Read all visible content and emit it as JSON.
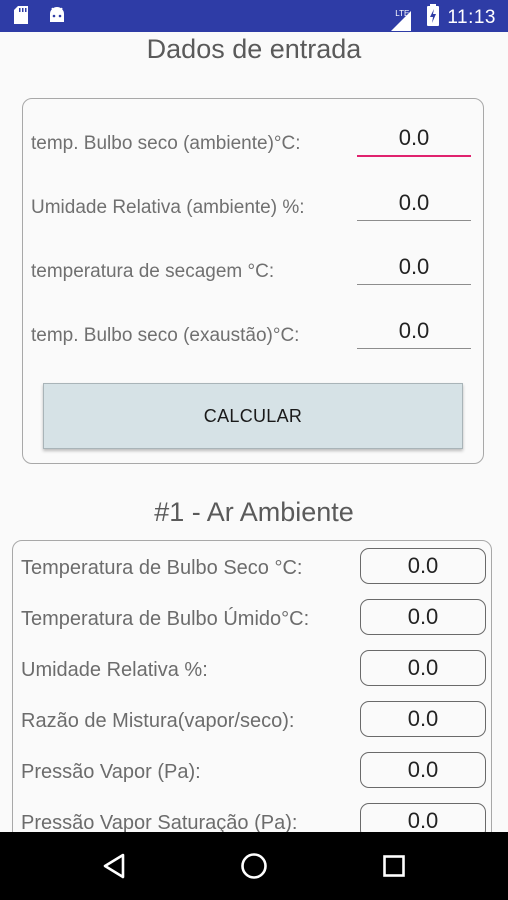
{
  "status_bar": {
    "time": "11:13",
    "network_label": "LTE",
    "icons": [
      "sd-card-icon",
      "android-icon",
      "signal-icon",
      "battery-charging-icon"
    ]
  },
  "input_section": {
    "title": "Dados de entrada",
    "fields": [
      {
        "label": "temp. Bulbo seco (ambiente)°C:",
        "value": "0.0",
        "focused": true
      },
      {
        "label": "Umidade Relativa (ambiente) %:",
        "value": "0.0",
        "focused": false
      },
      {
        "label": "temperatura de secagem °C:",
        "value": "0.0",
        "focused": false
      },
      {
        "label": "temp. Bulbo seco (exaustão)°C:",
        "value": "0.0",
        "focused": false
      }
    ],
    "calculate_label": "CALCULAR"
  },
  "results_section": {
    "title": "#1 - Ar Ambiente",
    "rows": [
      {
        "label": "Temperatura de Bulbo Seco °C:",
        "value": "0.0"
      },
      {
        "label": "Temperatura de Bulbo Úmido°C:",
        "value": "0.0"
      },
      {
        "label": "Umidade Relativa %:",
        "value": "0.0"
      },
      {
        "label": "Razão de Mistura(vapor/seco):",
        "value": "0.0"
      },
      {
        "label": "Pressão Vapor (Pa):",
        "value": "0.0"
      },
      {
        "label": "Pressão Vapor Saturação (Pa):",
        "value": "0.0"
      }
    ]
  },
  "nav_bar": {
    "buttons": [
      "back-icon",
      "home-icon",
      "recents-icon"
    ]
  },
  "colors": {
    "status_bar": "#2e3ca6",
    "focus_underline": "#e0226e",
    "button_bg": "#d6e2e6"
  }
}
